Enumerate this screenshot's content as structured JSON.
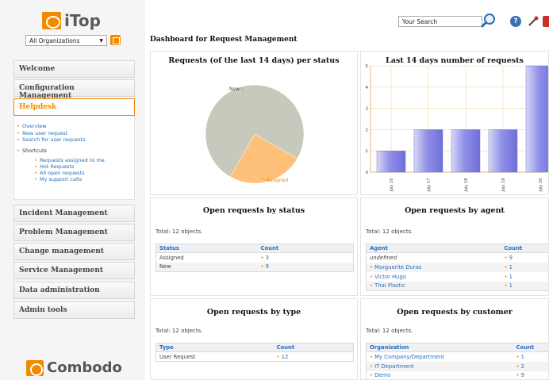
{
  "app": {
    "logo_text": "iTop",
    "footer_logo_text": "Combodo"
  },
  "org_filter": {
    "value": "All Organizations"
  },
  "search": {
    "value": "Your Search"
  },
  "menu": {
    "welcome": "Welcome",
    "configuration": "Configuration Management",
    "helpdesk": "Helpdesk",
    "incident": "Incident Management",
    "problem": "Problem Management",
    "change": "Change management",
    "service": "Service Management",
    "data_admin": "Data administration",
    "admin_tools": "Admin tools"
  },
  "helpdesk_links": {
    "overview": "Overview",
    "new_request": "New user request",
    "search_requests": "Search for user requests",
    "shortcuts": "Shortcuts",
    "assigned_to_me": "Requests assigned to me",
    "hot_requests": "Hot Requests",
    "all_open": "All open requests",
    "my_support_calls": "My support calls"
  },
  "dashboard": {
    "title": "Dashboard for Request Management"
  },
  "pie": {
    "title": "Requests (of the last 14 days) per status",
    "labels": {
      "new": "New",
      "assigned": "Assigned"
    }
  },
  "bar": {
    "title": "Last 14 days number of requests",
    "y_ticks": [
      "0",
      "1",
      "2",
      "3",
      "4",
      "5"
    ]
  },
  "chart_data": [
    {
      "type": "pie",
      "title": "Requests (of the last 14 days) per status",
      "categories": [
        "New",
        "Assigned"
      ],
      "values": [
        9,
        3
      ],
      "colors": [
        "#c7c9bd",
        "#ffc07a"
      ]
    },
    {
      "type": "bar",
      "title": "Last 14 days number of requests",
      "categories": [
        "July 16",
        "July 17",
        "July 18",
        "July 19",
        "July 20"
      ],
      "values": [
        1,
        2,
        2,
        2,
        5
      ],
      "ylim": [
        0,
        5
      ],
      "grid": true,
      "colors": [
        "#7f7fe0"
      ]
    }
  ],
  "status_dashlet": {
    "title": "Open requests by status",
    "total": "Total: 12 objects.",
    "headers": [
      "Status",
      "Count"
    ],
    "rows": [
      [
        "Assigned",
        "3"
      ],
      [
        "New",
        "9"
      ]
    ]
  },
  "agent_dashlet": {
    "title": "Open requests by agent",
    "total": "Total: 12 objects.",
    "headers": [
      "Agent",
      "Count"
    ],
    "rows": [
      [
        "undefined",
        "9"
      ],
      [
        "Marguerite Duras",
        "1"
      ],
      [
        "Victor Hugo",
        "1"
      ],
      [
        "Thai Plastic",
        "1"
      ]
    ]
  },
  "type_dashlet": {
    "title": "Open requests by type",
    "total": "Total: 12 objects.",
    "headers": [
      "Type",
      "Count"
    ],
    "rows": [
      [
        "User Request",
        "12"
      ]
    ]
  },
  "customer_dashlet": {
    "title": "Open requests by customer",
    "total": "Total: 12 objects.",
    "headers": [
      "Organization",
      "Count"
    ],
    "rows": [
      [
        "My Company/Department",
        "1"
      ],
      [
        "IT Department",
        "2"
      ],
      [
        "Demo",
        "9"
      ]
    ]
  },
  "colors": {
    "accent": "#f08a00",
    "link": "#2a6ebb"
  }
}
